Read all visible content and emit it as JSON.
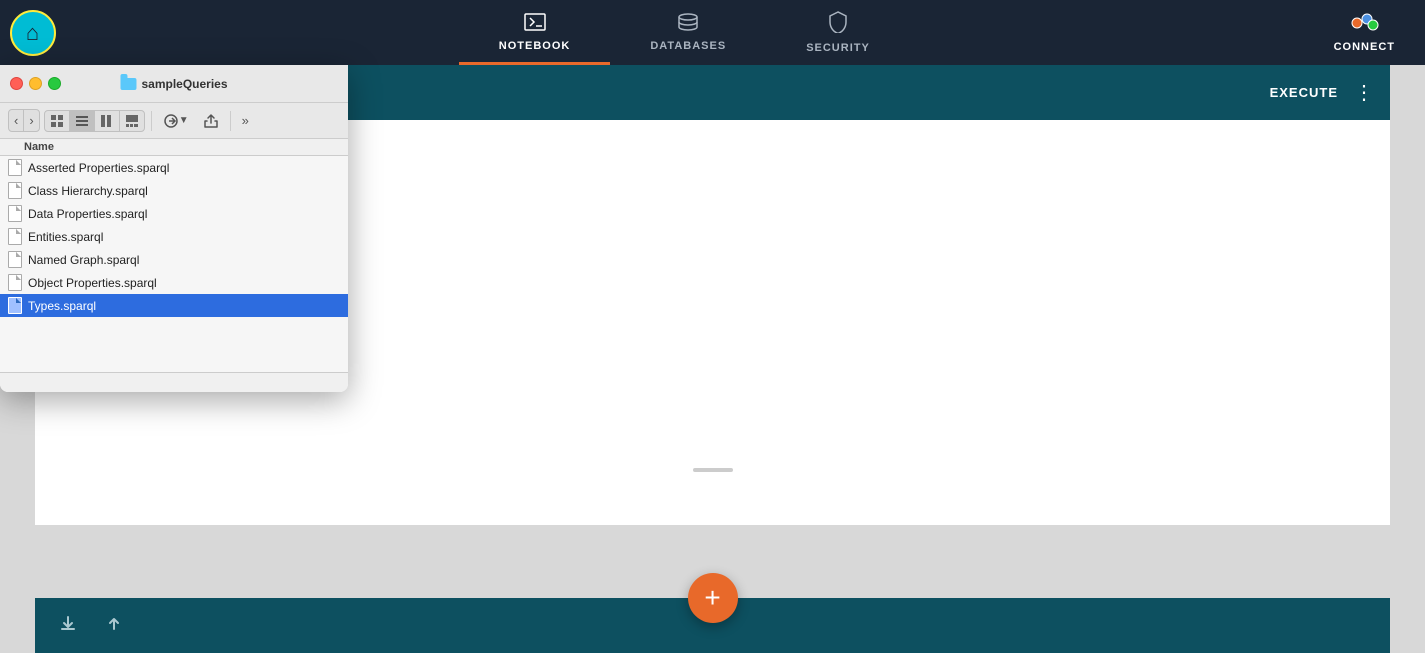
{
  "nav": {
    "tabs": [
      {
        "id": "notebook",
        "label": "NOTEBOOK",
        "active": true
      },
      {
        "id": "databases",
        "label": "DATABASES",
        "active": false
      },
      {
        "id": "security",
        "label": "SECURITY",
        "active": false
      }
    ],
    "connect_label": "CONNECT"
  },
  "finder": {
    "title": "sampleQueries",
    "col_header": "Name",
    "files": [
      {
        "name": "Asserted Properties.sparql",
        "selected": false
      },
      {
        "name": "Class Hierarchy.sparql",
        "selected": false
      },
      {
        "name": "Data Properties.sparql",
        "selected": false
      },
      {
        "name": "Entities.sparql",
        "selected": false
      },
      {
        "name": "Named Graph.sparql",
        "selected": false
      },
      {
        "name": "Object Properties.sparql",
        "selected": false
      },
      {
        "name": "Types.sparql",
        "selected": true
      }
    ],
    "buttons": {
      "back": "‹",
      "forward": "›"
    }
  },
  "notebook": {
    "execute_label": "EXECUTE",
    "more_label": "⋮",
    "footer": {
      "download_label": "⬇",
      "up_label": "⬆"
    }
  },
  "fab": {
    "label": "+"
  }
}
